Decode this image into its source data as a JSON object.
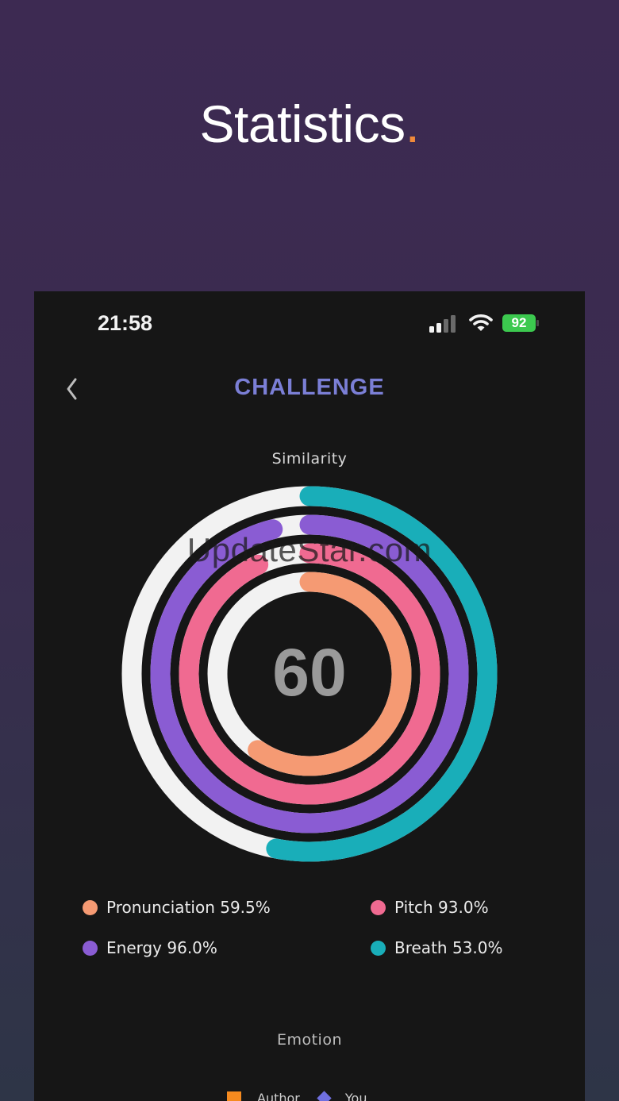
{
  "headline": {
    "text": "Statistics",
    "accent": "."
  },
  "status_bar": {
    "time": "21:58",
    "battery": "92"
  },
  "header": {
    "title": "CHALLENGE",
    "back_icon": "chevron-left-icon"
  },
  "similarity": {
    "label": "Similarity",
    "score": "60"
  },
  "watermark": "UpdateStar.com",
  "chart_data": {
    "type": "radial-bar",
    "title": "Similarity",
    "center_value": 60,
    "unit": "%",
    "series": [
      {
        "name": "Pronunciation",
        "value": 59.5,
        "color": "#f59a73"
      },
      {
        "name": "Pitch",
        "value": 93.0,
        "color": "#f06a91"
      },
      {
        "name": "Energy",
        "value": 96.0,
        "color": "#8a5cd3"
      },
      {
        "name": "Breath",
        "value": 53.0,
        "color": "#19aeb9"
      }
    ],
    "track_color": "#f2f2f2"
  },
  "legend": [
    {
      "label": "Pronunciation 59.5%",
      "color": "#f59a73"
    },
    {
      "label": "Pitch 93.0%",
      "color": "#f06a91"
    },
    {
      "label": "Energy 96.0%",
      "color": "#8a5cd3"
    },
    {
      "label": "Breath 53.0%",
      "color": "#19aeb9"
    }
  ],
  "emotion": {
    "label": "Emotion",
    "legend": [
      {
        "label": "Author",
        "color": "#f58a1f",
        "marker": "square"
      },
      {
        "label": "You",
        "color": "#6f6fe0",
        "marker": "diamond"
      }
    ]
  }
}
